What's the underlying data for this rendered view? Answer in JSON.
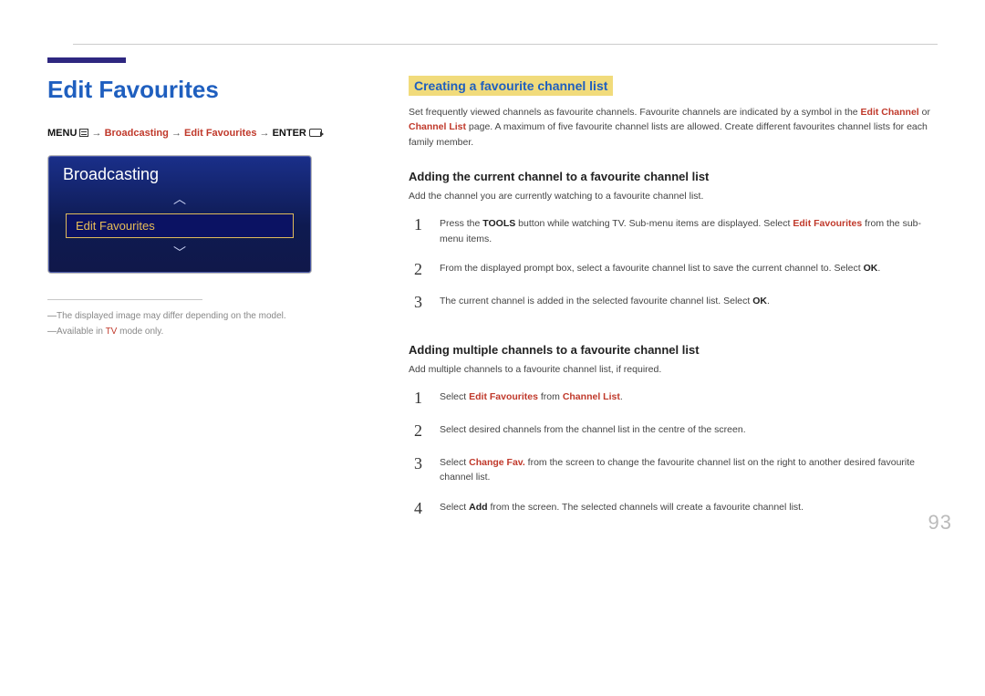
{
  "header": {
    "title": "Edit Favourites",
    "crumb": {
      "menu": "MENU",
      "arrow": "→",
      "seg1": "Broadcasting",
      "seg2": "Edit Favourites",
      "enter": "ENTER"
    }
  },
  "tv": {
    "panel_title": "Broadcasting",
    "item": "Edit Favourites",
    "chev_up": "︿",
    "chev_down": "﹀"
  },
  "notes": {
    "n1": "The displayed image may differ depending on the model.",
    "n2_pre": "Available in ",
    "n2_hl": "TV",
    "n2_post": " mode only."
  },
  "right": {
    "section_title": "Creating a favourite channel list",
    "intro_pre": "Set frequently viewed channels as favourite channels. Favourite channels are indicated by a symbol in the ",
    "intro_hl1": "Edit Channel",
    "intro_mid": " or ",
    "intro_hl2": "Channel List",
    "intro_post": " page. A maximum of five favourite channel lists are allowed. Create different favourites channel lists for each family member.",
    "sub1": "Adding the current channel to a favourite channel list",
    "lead1": "Add the channel you are currently watching to a favourite channel list.",
    "steps1": {
      "s1_pre": "Press the ",
      "s1_b": "TOOLS",
      "s1_mid": " button while watching TV. Sub-menu items are displayed. Select ",
      "s1_hl": "Edit Favourites",
      "s1_post": " from the sub-menu items.",
      "s2_pre": "From the displayed prompt box, select a favourite channel list to save the current channel to. Select ",
      "s2_b": "OK",
      "s2_post": ".",
      "s3_pre": "The current channel is added in the selected favourite channel list. Select ",
      "s3_b": "OK",
      "s3_post": "."
    },
    "sub2": "Adding multiple channels to a favourite channel list",
    "lead2": "Add multiple channels to a favourite channel list, if required.",
    "steps2": {
      "s1_pre": "Select ",
      "s1_hl1": "Edit Favourites",
      "s1_mid": " from ",
      "s1_hl2": "Channel List",
      "s1_post": ".",
      "s2": "Select desired channels from the channel list in the centre of the screen.",
      "s3_pre": "Select ",
      "s3_hl": "Change Fav.",
      "s3_post": " from the screen to change the favourite channel list on the right to another desired favourite channel list.",
      "s4_pre": "Select ",
      "s4_b": "Add",
      "s4_post": " from the screen. The selected channels will create a favourite channel list."
    }
  },
  "page_number": "93"
}
